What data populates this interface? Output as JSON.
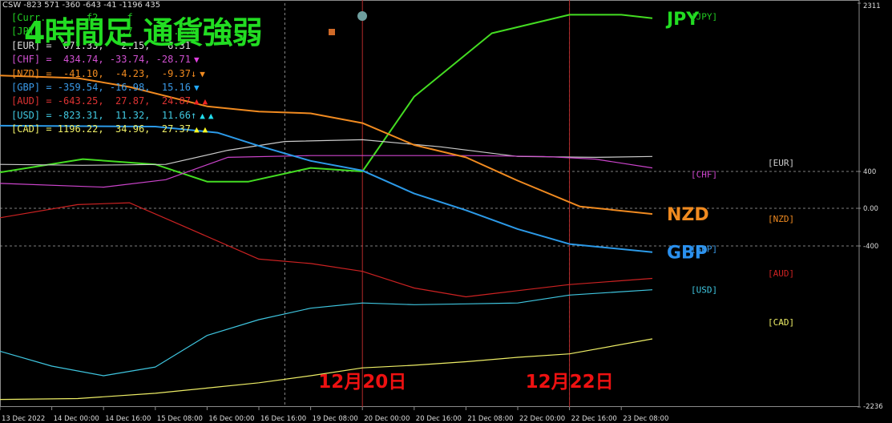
{
  "indicator_header": "CSW -823 571 -360 -643 -41 -1196 435",
  "overlay_title": "4時間足 通貨強弱",
  "colors": {
    "background": "#000000",
    "title": "#22dd22",
    "annotation_date": "#ee1111",
    "vline": "#b52a2a",
    "hline": "#aaaaaa",
    "grid": "#aaaaaa",
    "axis_text": "#dddddd",
    "marker_dot": "#6f9f9f",
    "marker_square": "#d06a28"
  },
  "legend_panel": {
    "rows": [
      {
        "text": "[Curr...  ...f2  ...f",
        "color": "#22cc22",
        "markers": []
      },
      {
        "text": "[JPY]  ...       ...7       ...w",
        "color": "#22cc22",
        "markers": []
      },
      {
        "text": "[EUR] =  871.33,   2.15,   6.31",
        "color": "#dddddd",
        "markers": []
      },
      {
        "text": "[CHF] =  434.74, -33.74, -28.71",
        "color": "#d050d0",
        "markers": [
          {
            "symbol": "▼",
            "color": "#e040e0"
          }
        ]
      },
      {
        "text": "[NZD] =  -41.10,  -4.23,  -9.37↓",
        "color": "#f08a20",
        "markers": [
          {
            "symbol": "▼",
            "color": "#f08a20"
          }
        ]
      },
      {
        "text": "[GBP] = -359.54, -16.98,  15.16",
        "color": "#3a9ae8",
        "markers": [
          {
            "symbol": "▼",
            "color": "#22aaff"
          }
        ]
      },
      {
        "text": "[AUD] = -643.25,  27.87,  24.87",
        "color": "#dd3333",
        "markers": [
          {
            "symbol": "▲",
            "color": "#ee2222"
          },
          {
            "symbol": "▲",
            "color": "#ee2222"
          }
        ]
      },
      {
        "text": "[USD] = -823.31,  11.32,  11.66↑",
        "color": "#40c8e0",
        "markers": [
          {
            "symbol": "▲",
            "color": "#22ddee"
          },
          {
            "symbol": "▲",
            "color": "#22ddee"
          }
        ]
      },
      {
        "text": "[CAD] = 1196.22,  34.96,  27.37",
        "color": "#eeee66",
        "markers": [
          {
            "symbol": "▲",
            "color": "#ffff22"
          },
          {
            "symbol": "▲",
            "color": "#ffff22"
          }
        ]
      }
    ]
  },
  "annotations": {
    "date_labels": [
      "12月20日",
      "12月22日"
    ]
  },
  "chart_data": {
    "type": "line",
    "ylim": [
      -2236,
      2311
    ],
    "y_axis_ticks": [
      {
        "value": 2311,
        "label": "2311"
      },
      {
        "value": 400,
        "label": "400"
      },
      {
        "value": 0,
        "label": "0.00"
      },
      {
        "value": -400,
        "label": "-400"
      },
      {
        "value": -2236,
        "label": "-2236"
      }
    ],
    "horizontal_levels": [
      400,
      0,
      -400
    ],
    "x_range": [
      0,
      13
    ],
    "x_ticks": [
      {
        "x": 0,
        "label": "13 Dec 2022"
      },
      {
        "x": 1,
        "label": "14 Dec 00:00"
      },
      {
        "x": 2,
        "label": "14 Dec 16:00"
      },
      {
        "x": 3,
        "label": "15 Dec 08:00"
      },
      {
        "x": 4,
        "label": "16 Dec 00:00"
      },
      {
        "x": 5,
        "label": "16 Dec 16:00"
      },
      {
        "x": 6,
        "label": "19 Dec 08:00"
      },
      {
        "x": 7,
        "label": "20 Dec 00:00"
      },
      {
        "x": 8,
        "label": "20 Dec 16:00"
      },
      {
        "x": 9,
        "label": "21 Dec 08:00"
      },
      {
        "x": 10,
        "label": "22 Dec 00:00"
      },
      {
        "x": 11,
        "label": "22 Dec 16:00"
      },
      {
        "x": 12,
        "label": "23 Dec 08:00"
      }
    ],
    "vertical_gridlines_x": [
      5.5,
      11
    ],
    "event_lines": [
      {
        "x": 7,
        "label_index": 0
      },
      {
        "x": 11,
        "label_index": 1
      }
    ],
    "series": [
      {
        "name": "JPY",
        "color": "#44dd22",
        "points": [
          [
            0,
            390
          ],
          [
            1.6,
            540
          ],
          [
            3,
            480
          ],
          [
            4,
            290
          ],
          [
            4.8,
            290
          ],
          [
            6,
            440
          ],
          [
            7,
            400
          ],
          [
            8,
            1250
          ],
          [
            9.5,
            1970
          ],
          [
            11,
            2180
          ],
          [
            12,
            2180
          ],
          [
            12.6,
            2140
          ]
        ],
        "label": {
          "text": "JPY",
          "color": "#22dd22",
          "size": 22
        }
      },
      {
        "name": "EUR",
        "color": "#cccccc",
        "points": [
          [
            0,
            480
          ],
          [
            1.6,
            470
          ],
          [
            3.2,
            480
          ],
          [
            4.4,
            640
          ],
          [
            5.5,
            740
          ],
          [
            7,
            760
          ],
          [
            8.5,
            680
          ],
          [
            10,
            570
          ],
          [
            11.5,
            560
          ],
          [
            12.6,
            570
          ]
        ],
        "label": null
      },
      {
        "name": "CHF",
        "color": "#cc44cc",
        "points": [
          [
            0,
            270
          ],
          [
            2,
            230
          ],
          [
            3.2,
            310
          ],
          [
            4.4,
            560
          ],
          [
            6,
            580
          ],
          [
            7.5,
            580
          ],
          [
            9,
            580
          ],
          [
            10.5,
            570
          ],
          [
            11.5,
            540
          ],
          [
            12.6,
            440
          ]
        ],
        "label": null
      },
      {
        "name": "NZD",
        "color": "#f08a20",
        "points": [
          [
            0,
            1490
          ],
          [
            1.5,
            1460
          ],
          [
            2.5,
            1360
          ],
          [
            4,
            1140
          ],
          [
            5,
            1080
          ],
          [
            6,
            1060
          ],
          [
            7,
            950
          ],
          [
            8,
            700
          ],
          [
            9,
            560
          ],
          [
            10,
            300
          ],
          [
            11.2,
            20
          ],
          [
            12.6,
            -60
          ]
        ],
        "label": {
          "text": "NZD",
          "color": "#f08a20",
          "size": 22
        }
      },
      {
        "name": "GBP",
        "color": "#2c9ae8",
        "points": [
          [
            0,
            920
          ],
          [
            3,
            910
          ],
          [
            4.2,
            840
          ],
          [
            5,
            690
          ],
          [
            6,
            520
          ],
          [
            7,
            410
          ],
          [
            8,
            160
          ],
          [
            9,
            -20
          ],
          [
            10,
            -220
          ],
          [
            11,
            -380
          ],
          [
            12.6,
            -470
          ]
        ],
        "label": {
          "text": "GBP",
          "color": "#2a90ee",
          "size": 22
        }
      },
      {
        "name": "AUD",
        "color": "#cc2222",
        "points": [
          [
            0,
            -100
          ],
          [
            1.5,
            40
          ],
          [
            2.5,
            60
          ],
          [
            3.5,
            -180
          ],
          [
            5,
            -550
          ],
          [
            6,
            -600
          ],
          [
            7,
            -690
          ],
          [
            8,
            -880
          ],
          [
            9,
            -980
          ],
          [
            10,
            -910
          ],
          [
            11,
            -840
          ],
          [
            12.6,
            -770
          ]
        ],
        "label": null
      },
      {
        "name": "USD",
        "color": "#3fc6e0",
        "points": [
          [
            0,
            -1600
          ],
          [
            1,
            -1770
          ],
          [
            2,
            -1880
          ],
          [
            3,
            -1780
          ],
          [
            4,
            -1420
          ],
          [
            5,
            -1240
          ],
          [
            6,
            -1110
          ],
          [
            7,
            -1050
          ],
          [
            8,
            -1070
          ],
          [
            9,
            -1060
          ],
          [
            10,
            -1050
          ],
          [
            11,
            -960
          ],
          [
            12.6,
            -900
          ]
        ],
        "label": null
      },
      {
        "name": "CAD",
        "color": "#eeee66",
        "points": [
          [
            0,
            -2150
          ],
          [
            1.5,
            -2140
          ],
          [
            3,
            -2080
          ],
          [
            4,
            -2020
          ],
          [
            5,
            -1960
          ],
          [
            6,
            -1880
          ],
          [
            7,
            -1790
          ],
          [
            8,
            -1760
          ],
          [
            9,
            -1720
          ],
          [
            10,
            -1670
          ],
          [
            11,
            -1630
          ],
          [
            12.6,
            -1460
          ]
        ],
        "label": null
      }
    ],
    "right_labels": [
      {
        "text": "[JPY]",
        "color": "#22cc22",
        "value": 2160,
        "col": 0
      },
      {
        "text": "[EUR]",
        "color": "#cccccc",
        "value": 500,
        "col": 1
      },
      {
        "text": "[CHF]",
        "color": "#cc44cc",
        "value": 370,
        "col": 0
      },
      {
        "text": "[NZD]",
        "color": "#f08a20",
        "value": -110,
        "col": 1
      },
      {
        "text": "[GBP]",
        "color": "#3a9ae8",
        "value": -430,
        "col": 0
      },
      {
        "text": "[AUD]",
        "color": "#cc2222",
        "value": -710,
        "col": 1
      },
      {
        "text": "[USD]",
        "color": "#3fc6e0",
        "value": -900,
        "col": 0
      },
      {
        "text": "[CAD]",
        "color": "#eeee66",
        "value": -1270,
        "col": 1
      }
    ]
  }
}
